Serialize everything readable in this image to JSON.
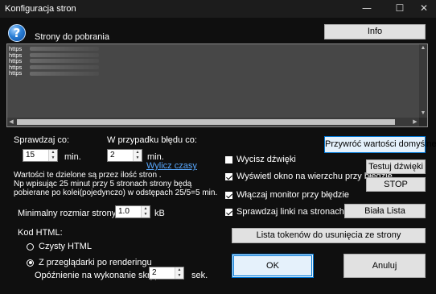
{
  "window": {
    "title": "Konfiguracja stron",
    "minimize_glyph": "—",
    "maximize_glyph": "☐",
    "close_glyph": "✕"
  },
  "help_icon": {
    "glyph": "?",
    "name": "help-icon"
  },
  "pages_label": "Strony do pobrania",
  "info_button": "Info",
  "url_list": [
    "https",
    "https",
    "https",
    "https",
    "https"
  ],
  "check_every": {
    "label": "Sprawdzaj co:",
    "value": "15",
    "unit": "min."
  },
  "on_error": {
    "label": "W przypadku błędu co:",
    "value": "2",
    "unit": "min.",
    "link": "Wylicz czasy"
  },
  "info_text": [
    "Wartości te dzielone są przez ilość stron .",
    "Np wpisując 25 minut przy 5 stronach strony będą",
    "pobierane po kolei(pojedynczo) w odstępach 25/5=5 min."
  ],
  "min_size": {
    "label": "Minimalny rozmiar strony:",
    "value": "1.0",
    "unit": "kB"
  },
  "html_code": {
    "label": "Kod HTML:",
    "options": [
      {
        "label": "Czysty HTML",
        "selected": false
      },
      {
        "label": "Z przeglądarki po renderingu",
        "selected": true
      }
    ],
    "delay_label": "Opóźnienie na wykonanie skryptów:",
    "delay_value": "2",
    "delay_unit": "sek."
  },
  "restore_defaults_button": "Przywróć wartości domyślne",
  "options": [
    {
      "label": "Wycisz dźwięki",
      "checked": false
    },
    {
      "label": "Wyświetl okno na wierzchu przy błedzie",
      "checked": true
    },
    {
      "label": "Włączaj monitor przy błędzie",
      "checked": true
    },
    {
      "label": "Sprawdzaj linki na stronach",
      "checked": true
    }
  ],
  "test_sound_button": "Testuj dźwięki",
  "stop_button": "STOP",
  "whitelist_button": "Biała Lista",
  "token_list_button": "Lista tokenów do usunięcia ze strony",
  "ok_button": "OK",
  "cancel_button": "Anuluj",
  "colors": {
    "background": "#0f0f0f",
    "button_face": "#e1e1e1",
    "accent": "#0078d7",
    "link": "#59a9ff",
    "list_bg": "#474747"
  }
}
